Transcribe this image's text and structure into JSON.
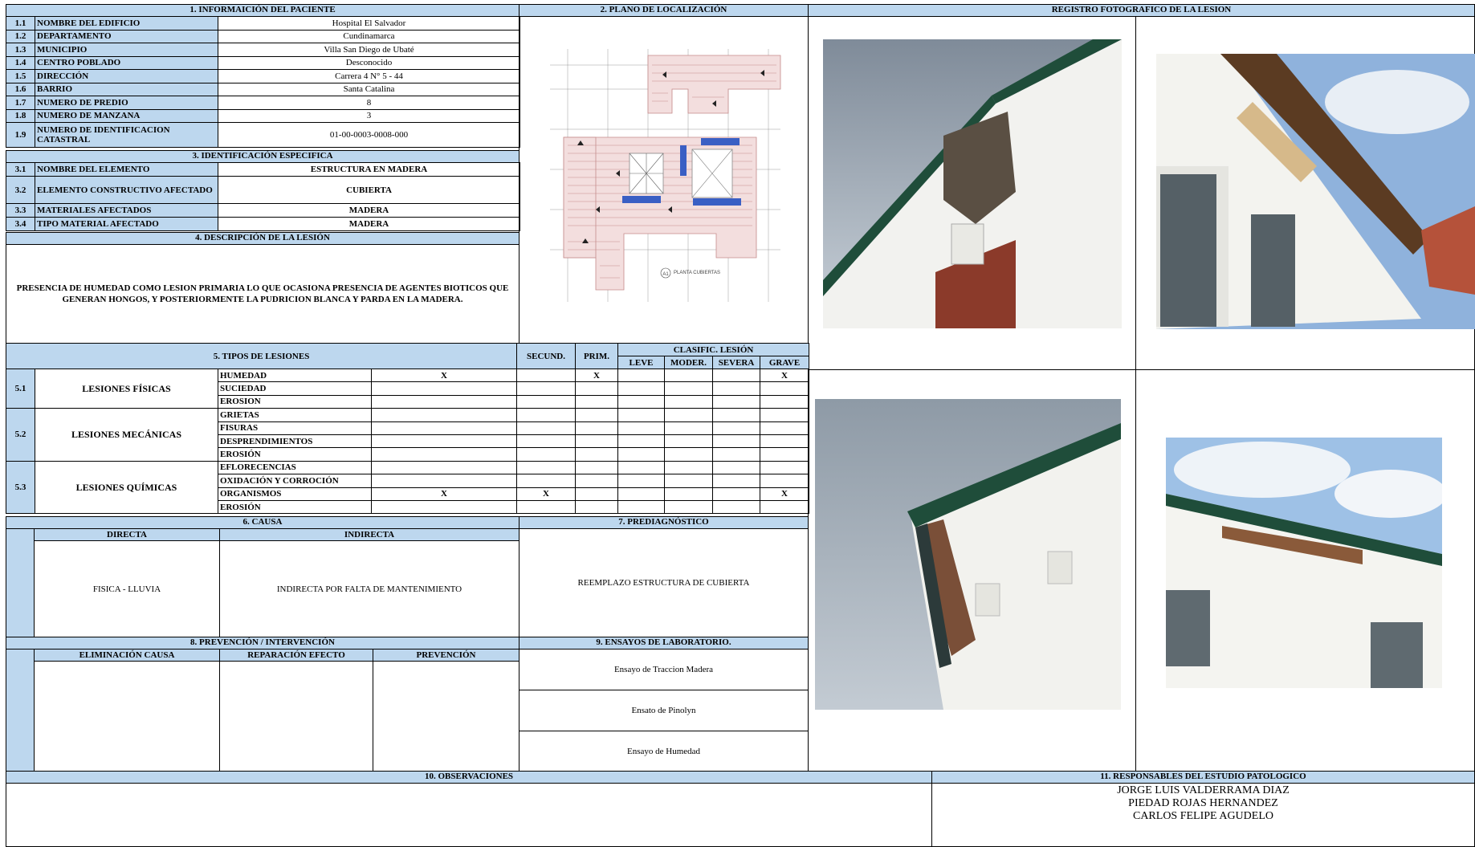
{
  "sections": {
    "s1": "1. INFORMAICIÓN DEL PACIENTE",
    "s2": "2. PLANO DE LOCALIZACIÓN",
    "photo_reg": "REGISTRO FOTOGRAFICO DE LA LESION",
    "s3": "3. IDENTIFICACIÓN ESPECIFICA",
    "s4": "4. DESCRIPCIÓN DE LA LESIÓN",
    "s5": "5. TIPOS DE LESIONES",
    "s6": "6. CAUSA",
    "s7": "7. PREDIAGNÓSTICO",
    "s8": "8. PREVENCIÓN / INTERVENCIÓN",
    "s9": "9. ENSAYOS DE LABORATORIO.",
    "s10": "10. OBSERVACIONES",
    "s11": "11. RESPONSABLES DEL ESTUDIO PATOLOGICO"
  },
  "info": [
    {
      "num": "1.1",
      "label": "NOMBRE DEL EDIFICIO",
      "value": "Hospital El Salvador"
    },
    {
      "num": "1.2",
      "label": "DEPARTAMENTO",
      "value": "Cundinamarca"
    },
    {
      "num": "1.3",
      "label": "MUNICIPIO",
      "value": "Villa San Diego de Ubaté"
    },
    {
      "num": "1.4",
      "label": "CENTRO POBLADO",
      "value": "Desconocido"
    },
    {
      "num": "1.5",
      "label": "DIRECCIÓN",
      "value": "Carrera 4 N° 5 - 44"
    },
    {
      "num": "1.6",
      "label": "BARRIO",
      "value": "Santa Catalina"
    },
    {
      "num": "1.7",
      "label": "NUMERO DE PREDIO",
      "value": "8"
    },
    {
      "num": "1.8",
      "label": "NUMERO DE MANZANA",
      "value": "3"
    },
    {
      "num": "1.9",
      "label": "NUMERO DE IDENTIFICACION CATASTRAL",
      "value": "01-00-0003-0008-000"
    }
  ],
  "ident": [
    {
      "num": "3.1",
      "label": "NOMBRE DEL ELEMENTO",
      "value": "ESTRUCTURA EN MADERA"
    },
    {
      "num": "3.2",
      "label": "ELEMENTO CONSTRUCTIVO AFECTADO",
      "value": "CUBIERTA"
    },
    {
      "num": "3.3",
      "label": "MATERIALES AFECTADOS",
      "value": "MADERA"
    },
    {
      "num": "3.4",
      "label": "TIPO MATERIAL AFECTADO",
      "value": "MADERA"
    }
  ],
  "description": "PRESENCIA DE HUMEDAD COMO LESION PRIMARIA LO QUE OCASIONA PRESENCIA DE AGENTES BIOTICOS QUE GENERAN HONGOS, Y POSTERIORMENTE LA PUDRICION BLANCA Y PARDA EN LA MADERA.",
  "plan_label": "PLANTA CUBIERTAS",
  "plan_tag": "A1",
  "lesion_headers": {
    "secund": "SECUND.",
    "prim": "PRIM.",
    "clasif": "CLASIFIC. LESIÓN",
    "leve": "LEVE",
    "moder": "MODER.",
    "severa": "SEVERA",
    "grave": "GRAVE"
  },
  "lesions": [
    {
      "num": "5.1",
      "group": "LESIONES FÍSICAS",
      "items": [
        {
          "name": "HUMEDAD",
          "col": "X",
          "secund": "",
          "prim": "X",
          "grave": "X"
        },
        {
          "name": "SUCIEDAD",
          "col": "",
          "secund": "",
          "prim": "",
          "grave": ""
        },
        {
          "name": "EROSION",
          "col": "",
          "secund": "",
          "prim": "",
          "grave": ""
        }
      ]
    },
    {
      "num": "5.2",
      "group": "LESIONES MECÁNICAS",
      "items": [
        {
          "name": "GRIETAS",
          "col": "",
          "secund": "",
          "prim": "",
          "grave": ""
        },
        {
          "name": "FISURAS",
          "col": "",
          "secund": "",
          "prim": "",
          "grave": ""
        },
        {
          "name": "DESPRENDIMIENTOS",
          "col": "",
          "secund": "",
          "prim": "",
          "grave": ""
        },
        {
          "name": "EROSIÓN",
          "col": "",
          "secund": "",
          "prim": "",
          "grave": ""
        }
      ]
    },
    {
      "num": "5.3",
      "group": "LESIONES QUÍMICAS",
      "items": [
        {
          "name": "EFLORECENCIAS",
          "col": "",
          "secund": "",
          "prim": "",
          "grave": ""
        },
        {
          "name": "OXIDACIÓN Y CORROCIÓN",
          "col": "",
          "secund": "",
          "prim": "",
          "grave": ""
        },
        {
          "name": "ORGANISMOS",
          "col": "X",
          "secund": "X",
          "prim": "",
          "grave": "X"
        },
        {
          "name": "EROSIÓN",
          "col": "",
          "secund": "",
          "prim": "",
          "grave": ""
        }
      ]
    }
  ],
  "cause": {
    "directa_h": "DIRECTA",
    "indirecta_h": "INDIRECTA",
    "directa": "FISICA - LLUVIA",
    "indirecta": "INDIRECTA POR FALTA DE MANTENIMIENTO"
  },
  "prediagnostico": "REEMPLAZO ESTRUCTURA DE CUBIERTA",
  "prevention": {
    "h1": "ELIMINACIÓN CAUSA",
    "h2": "REPARACIÓN EFECTO",
    "h3": "PREVENCIÓN"
  },
  "ensayos": [
    "Ensayo de Traccion Madera",
    "Ensato de Pinolyn",
    "Ensayo de Humedad"
  ],
  "responsables": [
    "JORGE LUIS VALDERRAMA DIAZ",
    "PIEDAD ROJAS HERNANDEZ",
    "CARLOS FELIPE AGUDELO"
  ],
  "colors": {
    "header_blue": "#bdd7ee",
    "roof_green": "#1f4d3a",
    "sky": "#a9b6c4"
  }
}
